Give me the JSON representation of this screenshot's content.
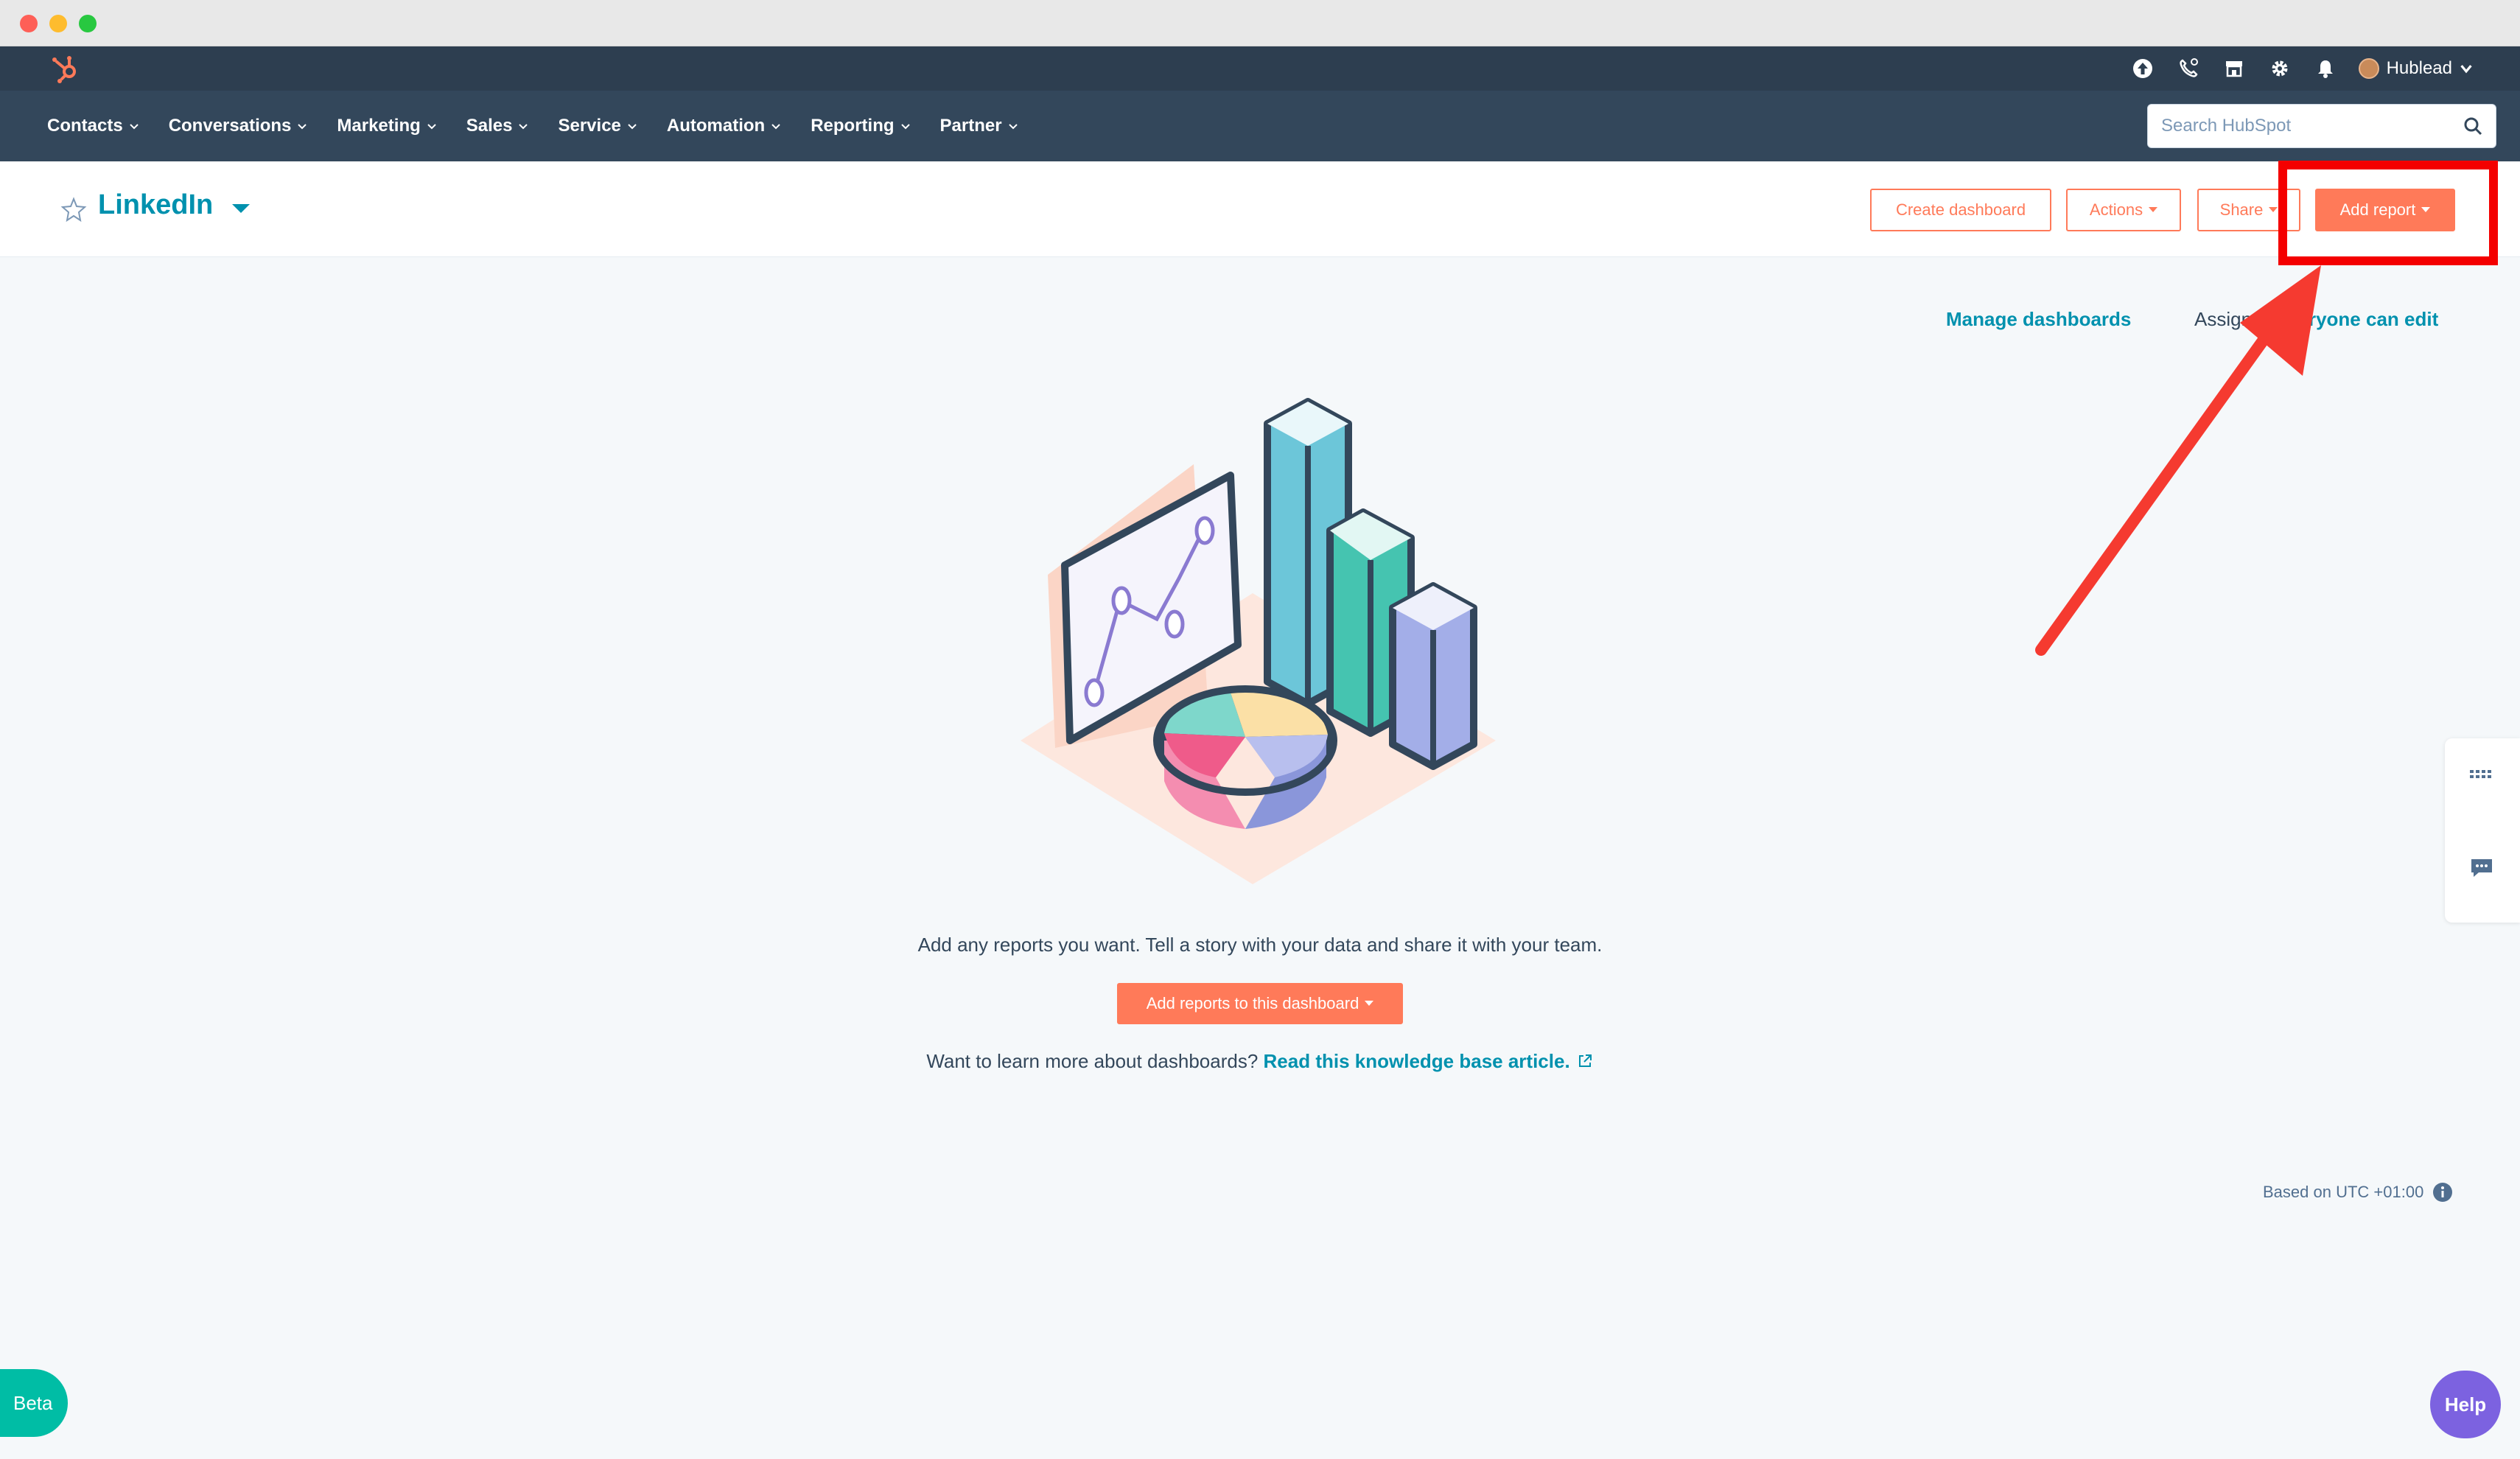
{
  "topbar": {
    "icons": [
      "upgrade-icon",
      "calling-icon",
      "marketplace-icon",
      "settings-icon",
      "notifications-icon"
    ],
    "account_name": "Hublead"
  },
  "nav": {
    "items": [
      {
        "label": "Contacts"
      },
      {
        "label": "Conversations"
      },
      {
        "label": "Marketing"
      },
      {
        "label": "Sales"
      },
      {
        "label": "Service"
      },
      {
        "label": "Automation"
      },
      {
        "label": "Reporting"
      },
      {
        "label": "Partner"
      }
    ],
    "search_placeholder": "Search HubSpot"
  },
  "dashboard": {
    "title": "LinkedIn",
    "create_label": "Create dashboard",
    "actions_label": "Actions",
    "share_label": "Share",
    "add_report_label": "Add report",
    "manage_label": "Manage dashboards",
    "assigned_prefix": "Assigne",
    "assigned_value": "eryone can edit"
  },
  "empty_state": {
    "message": "Add any reports you want. Tell a story with your data and share it with your team.",
    "add_reports_label": "Add reports to this dashboard",
    "learn_prefix": "Want to learn more about dashboards?",
    "learn_link": "Read this knowledge base article."
  },
  "footer": {
    "timezone": "Based on UTC +01:00",
    "beta_label": "Beta",
    "help_label": "Help"
  },
  "colors": {
    "accent": "#ff7a59",
    "link": "#0091ae",
    "nav_bg": "#33475b",
    "highlight": "#f40000"
  }
}
